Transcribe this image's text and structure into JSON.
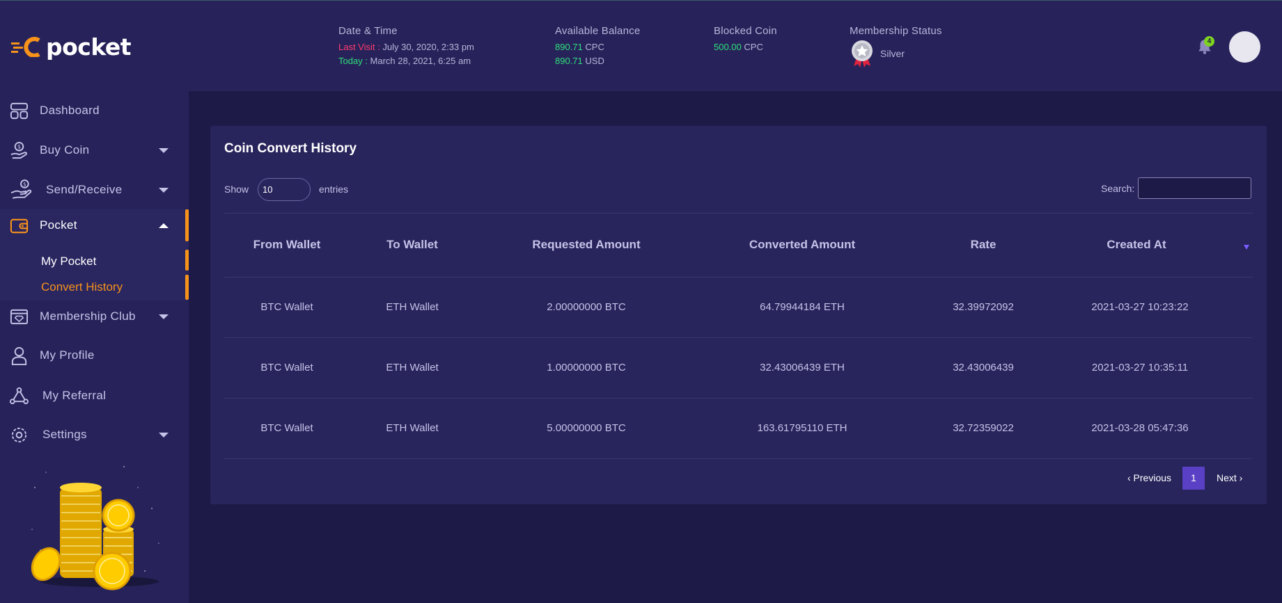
{
  "header": {
    "logo_text": "pocket",
    "date_time": {
      "label": "Date & Time",
      "last_visit_label": "Last Visit :",
      "last_visit_value": "July 30, 2020, 2:33 pm",
      "today_label": "Today :",
      "today_value": "March 28, 2021, 6:25 am"
    },
    "balance": {
      "label": "Available Balance",
      "cpc_amount": "890.71",
      "cpc_unit": "CPC",
      "usd_amount": "890.71",
      "usd_unit": "USD"
    },
    "blocked": {
      "label": "Blocked Coin",
      "amount": "500.00",
      "unit": "CPC"
    },
    "membership": {
      "label": "Membership Status",
      "value": "Silver"
    },
    "notification_count": "4"
  },
  "sidebar": {
    "items": [
      {
        "label": "Dashboard",
        "icon": "dashboard-icon"
      },
      {
        "label": "Buy Coin",
        "icon": "coin-hand-icon"
      },
      {
        "label": "Send/Receive",
        "icon": "send-receive-icon"
      },
      {
        "label": "Pocket",
        "icon": "wallet-icon"
      },
      {
        "label": "Membership Club",
        "icon": "membership-icon"
      },
      {
        "label": "My Profile",
        "icon": "user-icon"
      },
      {
        "label": "My Referral",
        "icon": "referral-icon"
      },
      {
        "label": "Settings",
        "icon": "gear-icon"
      }
    ],
    "pocket_sub": [
      "My Pocket",
      "Convert History"
    ]
  },
  "main": {
    "title": "Coin Convert History",
    "show_label": "Show",
    "entries_value": "10",
    "entries_label": "entries",
    "search_label": "Search:",
    "columns": [
      "From Wallet",
      "To Wallet",
      "Requested Amount",
      "Converted Amount",
      "Rate",
      "Created At"
    ],
    "rows": [
      [
        "BTC Wallet",
        "ETH Wallet",
        "2.00000000 BTC",
        "64.79944184 ETH",
        "32.39972092",
        "2021-03-27 10:23:22"
      ],
      [
        "BTC Wallet",
        "ETH Wallet",
        "1.00000000 BTC",
        "32.43006439 ETH",
        "32.43006439",
        "2021-03-27 10:35:11"
      ],
      [
        "BTC Wallet",
        "ETH Wallet",
        "5.00000000 BTC",
        "163.61795110 ETH",
        "32.72359022",
        "2021-03-28 05:47:36"
      ]
    ],
    "pagination": {
      "previous": "‹ Previous",
      "page": "1",
      "next": "Next ›"
    }
  },
  "colors": {
    "background": "#1e1a47",
    "panel": "#27235a",
    "accent_orange": "#f7931a",
    "accent_green": "#2ee07a",
    "accent_red": "#ff3a6b",
    "accent_purple": "#5a40c4"
  }
}
